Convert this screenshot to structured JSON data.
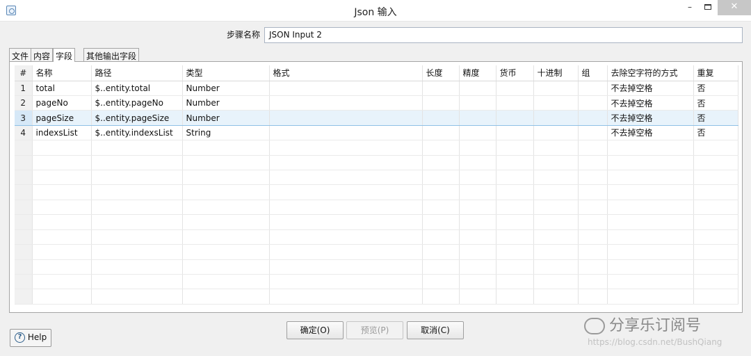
{
  "window": {
    "title": "Json 输入"
  },
  "step": {
    "label": "步骤名称",
    "value": "JSON Input 2"
  },
  "tabs": [
    "文件",
    "内容",
    "字段",
    "其他输出字段"
  ],
  "active_tab": "字段",
  "grid": {
    "columns": [
      "#",
      "名称",
      "路径",
      "类型",
      "格式",
      "长度",
      "精度",
      "货币",
      "十进制",
      "组",
      "去除空字符的方式",
      "重复"
    ],
    "rows": [
      {
        "idx": "1",
        "name": "total",
        "path": "$..entity.total",
        "type": "Number",
        "format": "",
        "length": "",
        "precision": "",
        "currency": "",
        "decimal": "",
        "group": "",
        "trim": "不去掉空格",
        "repeat": "否"
      },
      {
        "idx": "2",
        "name": "pageNo",
        "path": "$..entity.pageNo",
        "type": "Number",
        "format": "",
        "length": "",
        "precision": "",
        "currency": "",
        "decimal": "",
        "group": "",
        "trim": "不去掉空格",
        "repeat": "否"
      },
      {
        "idx": "3",
        "name": "pageSize",
        "path": "$..entity.pageSize",
        "type": "Number",
        "format": "",
        "length": "",
        "precision": "",
        "currency": "",
        "decimal": "",
        "group": "",
        "trim": "不去掉空格",
        "repeat": "否"
      },
      {
        "idx": "4",
        "name": "indexsList",
        "path": "$..entity.indexsList",
        "type": "String",
        "format": "",
        "length": "",
        "precision": "",
        "currency": "",
        "decimal": "",
        "group": "",
        "trim": "不去掉空格",
        "repeat": "否"
      }
    ],
    "selected_row": 3
  },
  "buttons": {
    "help": "Help",
    "ok": "确定(O)",
    "preview": "预览(P)",
    "cancel": "取消(C)"
  },
  "watermark": {
    "text": "分享乐订阅号",
    "url": "https://blog.csdn.net/BushQiang"
  },
  "icons": {
    "app": "json-input-icon",
    "help": "question-circle-icon"
  }
}
